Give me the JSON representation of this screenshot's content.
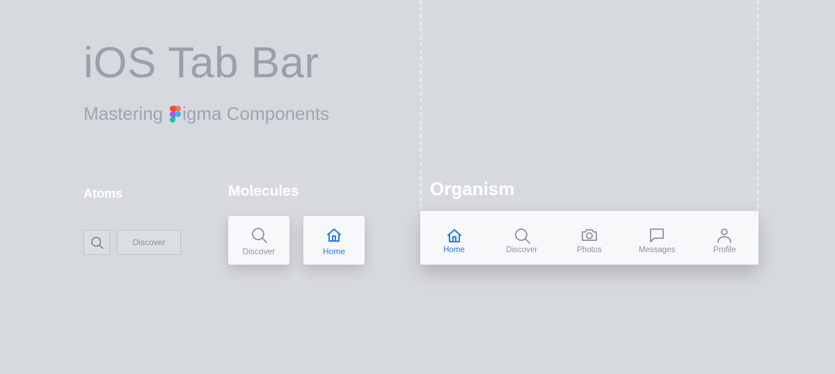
{
  "title": "iOS Tab Bar",
  "subtitle_pre": "Mastering",
  "subtitle_post": "igma Components",
  "sections": {
    "atoms": "Atoms",
    "molecules": "Molecules",
    "organism": "Organism"
  },
  "atoms": {
    "icon_name": "search-icon",
    "label": "Discover"
  },
  "molecules": [
    {
      "icon": "search-icon",
      "label": "Discover",
      "active": false
    },
    {
      "icon": "home-icon",
      "label": "Home",
      "active": true
    }
  ],
  "organism_tabs": [
    {
      "icon": "home-icon",
      "label": "Home",
      "active": true
    },
    {
      "icon": "search-icon",
      "label": "Discover",
      "active": false
    },
    {
      "icon": "camera-icon",
      "label": "Photos",
      "active": false
    },
    {
      "icon": "message-icon",
      "label": "Messages",
      "active": false
    },
    {
      "icon": "profile-icon",
      "label": "Profile",
      "active": false
    }
  ],
  "colors": {
    "accent": "#1f7af2",
    "inactive": "#8b919a"
  }
}
